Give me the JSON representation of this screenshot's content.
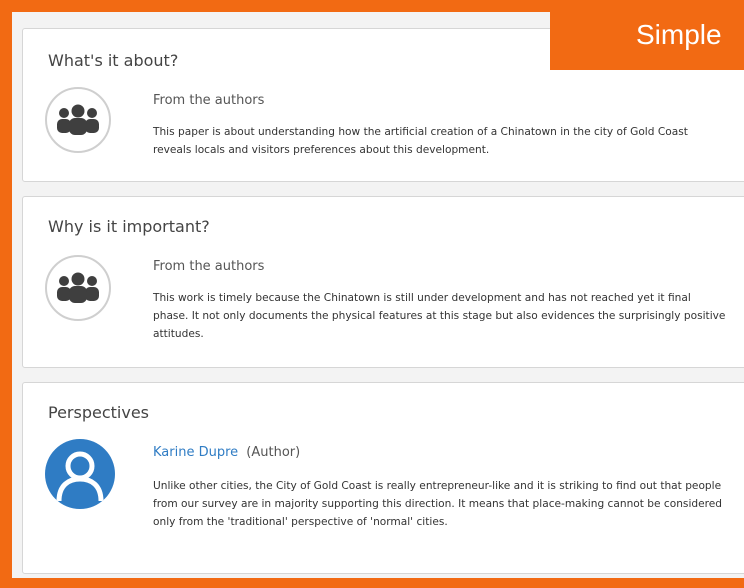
{
  "header": {
    "tab_label": "Simple"
  },
  "sections": [
    {
      "title": "What's it about?",
      "source": "From the authors",
      "text": "This paper is about understanding how the artificial creation of a Chinatown in the city of Gold Coast reveals locals and visitors preferences about this development."
    },
    {
      "title": "Why is it important?",
      "source": "From the authors",
      "text": "This work is timely because the Chinatown is still under development and has not reached yet it final phase. It not only documents the physical features at this stage but also evidences the surprisingly positive attitudes."
    }
  ],
  "perspectives": {
    "title": "Perspectives",
    "author_name": "Karine Dupre",
    "author_role": "(Author)",
    "text": "Unlike other cities, the City of Gold Coast is really entrepreneur-like and it is striking to find out that people from our survey are in majority supporting this direction. It means that place-making cannot be considered only from the 'traditional' perspective of 'normal' cities."
  },
  "colors": {
    "accent": "#f26a13",
    "link": "#2f7cc4",
    "icon_gray": "#3f3f3f"
  },
  "icons": {
    "group": "group-people-icon",
    "user": "user-avatar-icon"
  }
}
